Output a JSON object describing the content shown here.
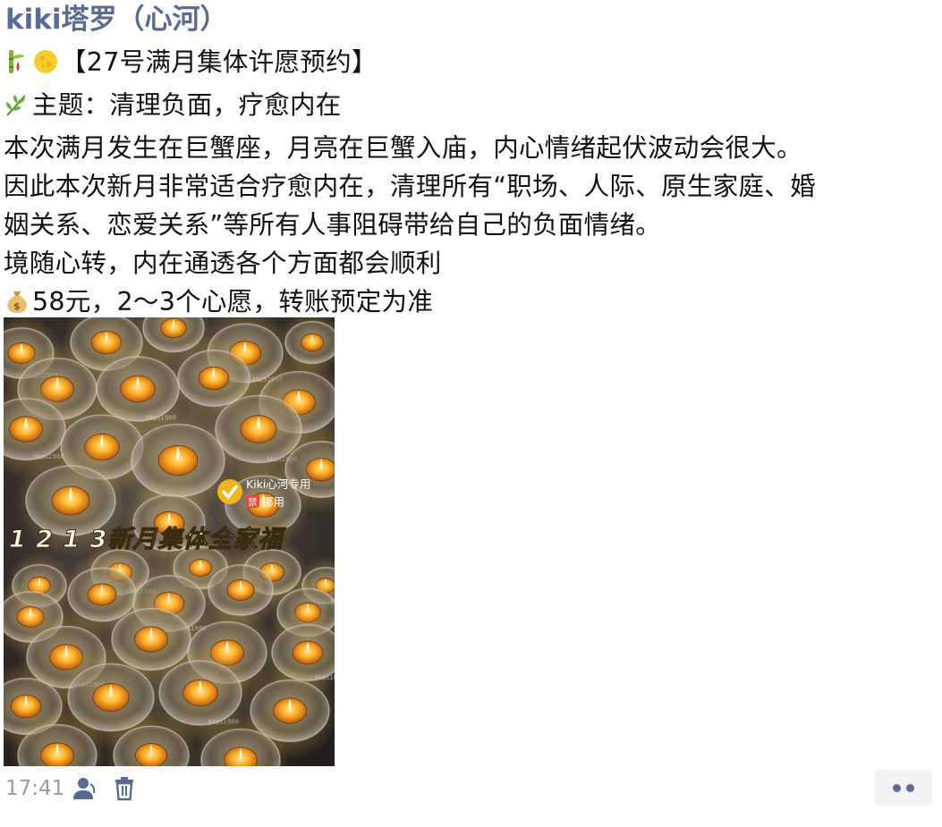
{
  "author": {
    "name": "kiki塔罗（心河）"
  },
  "post": {
    "title_icons": [
      "bamboo-icon",
      "full-moon-icon"
    ],
    "title": "【27号满月集体许愿预约】",
    "theme_icon": "herb-icon",
    "theme": "主题：清理负面，疗愈内在",
    "para_line1": "本次满月发生在巨蟹座，月亮在巨蟹入庙，内心情绪起伏波动会很大。",
    "para_line2": "因此本次新月非常适合疗愈内在，清理所有“职场、人际、原生家庭、婚",
    "para_line3": "姻关系、恋爱关系”等所有人事阻碍带给自己的负面情绪。",
    "motto": "境随心转，内在通透各个方面都会顺利",
    "price_icon": "money-bag-icon",
    "price": "58元，2～3个心愿，转账预定为准"
  },
  "photo": {
    "caption": "1 2 1 3新月集体全家福",
    "stamp_text": "Kiki心河专用",
    "stamp_badge": "禁",
    "stamp_sub": "挪用",
    "watermark": "kkps1988"
  },
  "footer": {
    "time": "17:41",
    "visibility_icon": "people-icon",
    "delete_icon": "trash-icon",
    "more_icon": "more-dots-icon"
  },
  "colors": {
    "link_blue": "#576b95",
    "muted": "#9a9a9a",
    "candle_glow": "#ffb229"
  }
}
